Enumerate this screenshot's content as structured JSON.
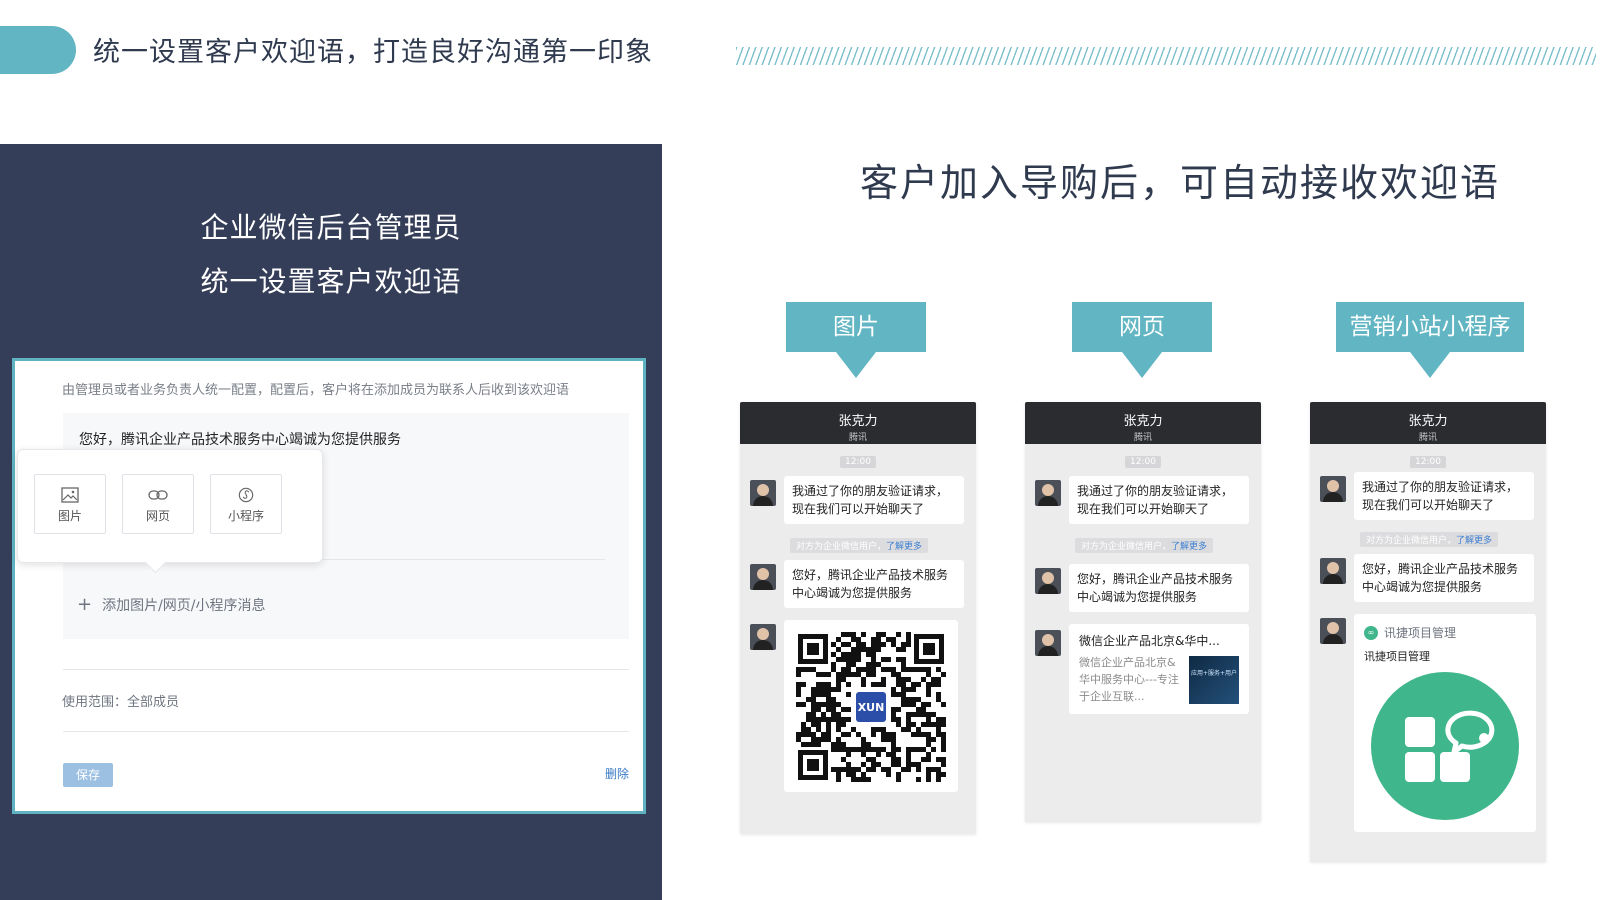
{
  "header": {
    "title": "统一设置客户欢迎语，打造良好沟通第一印象",
    "accent_color": "#62b6c3"
  },
  "left_panel": {
    "title_line1": "企业微信后台管理员",
    "title_line2": "统一设置客户欢迎语",
    "background": "#353e58",
    "form": {
      "description": "由管理员或者业务负责人统一配置，配置后，客户将在添加成员为联系人后收到该欢迎语",
      "message": "您好，腾讯企业产品技术服务中心竭诚为您提供服务",
      "popup_options": [
        {
          "label": "图片",
          "icon": "image-icon"
        },
        {
          "label": "网页",
          "icon": "link-icon"
        },
        {
          "label": "小程序",
          "icon": "mini-program-icon"
        }
      ],
      "add_label": "添加图片/网页/小程序消息",
      "add_icon": "plus-icon",
      "scope_label": "使用范围：全部成员",
      "save_label": "保存",
      "delete_label": "删除"
    }
  },
  "right": {
    "title": "客户加入导购后，可自动接收欢迎语",
    "labels": [
      "图片",
      "网页",
      "营销小站小程序"
    ],
    "phones": [
      {
        "contact_name": "张克力",
        "company": "腾讯",
        "time": "12:00",
        "greeting": "我通过了你的朋友验证请求，现在我们可以开始聊天了",
        "notice": "对方为企业微信用户，",
        "notice_link": "了解更多",
        "welcome": "您好，腾讯企业产品技术服务中心竭诚为您提供服务",
        "qr_center_text": "XUN"
      },
      {
        "contact_name": "张克力",
        "company": "腾讯",
        "time": "12:00",
        "greeting": "我通过了你的朋友验证请求，现在我们可以开始聊天了",
        "notice": "对方为企业微信用户，",
        "notice_link": "了解更多",
        "welcome": "您好，腾讯企业产品技术服务中心竭诚为您提供服务",
        "card_title": "微信企业产品北京&华中...",
        "card_desc": "微信企业产品北京&华中服务中心---专注于企业互联...",
        "card_thumb_text": "应用+服务+用户"
      },
      {
        "contact_name": "张克力",
        "company": "腾讯",
        "time": "12:00",
        "greeting": "我通过了你的朋友验证请求，现在我们可以开始聊天了",
        "notice": "对方为企业微信用户，",
        "notice_link": "了解更多",
        "welcome": "您好，腾讯企业产品技术服务中心竭诚为您提供服务",
        "mp_source": "讯捷项目管理",
        "mp_name": "讯捷项目管理",
        "mp_color": "#3fb68b"
      }
    ]
  }
}
